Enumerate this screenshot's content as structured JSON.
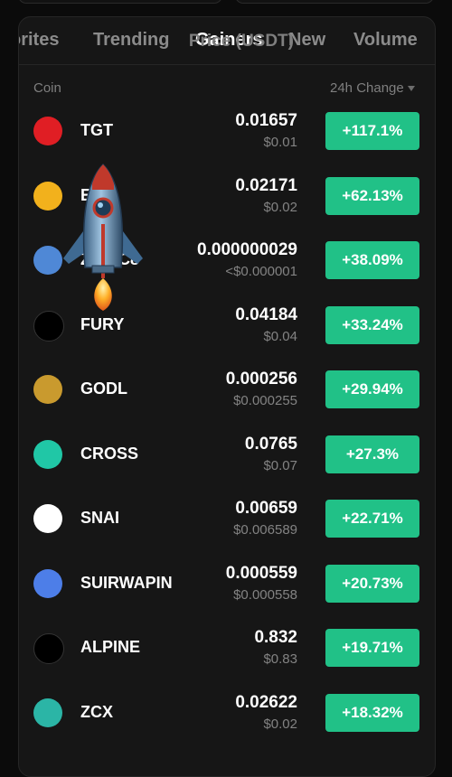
{
  "tabs": [
    {
      "label": "orites"
    },
    {
      "label": "Trending"
    },
    {
      "label": "Gainers"
    },
    {
      "label": "New"
    },
    {
      "label": "Volume"
    }
  ],
  "active_tab": "Gainers",
  "columns": {
    "coin": "Coin",
    "price": "Price (USDT)",
    "change": "24h Change"
  },
  "rows": [
    {
      "symbol": "TGT",
      "price": "0.01657",
      "usd": "$0.01",
      "change": "+117.1%",
      "icon": "tgt-logo-icon",
      "icon_color": "#e01e24"
    },
    {
      "symbol": "E",
      "price": "0.02171",
      "usd": "$0.02",
      "change": "+62.13%",
      "icon": "coin-e-logo-icon",
      "icon_color": "#f2b11c"
    },
    {
      "symbol": "ZU  CC8",
      "price": "0.000000029",
      "usd": "<$0.000001",
      "change": "+38.09%",
      "icon": "dog-logo-icon",
      "icon_color": "#4f88d6"
    },
    {
      "symbol": "FURY",
      "price": "0.04184",
      "usd": "$0.04",
      "change": "+33.24%",
      "icon": "fury-logo-icon",
      "icon_color": "#000000"
    },
    {
      "symbol": "GODL",
      "price": "0.000256",
      "usd": "$0.000255",
      "change": "+29.94%",
      "icon": "godl-logo-icon",
      "icon_color": "#c99a2e"
    },
    {
      "symbol": "CROSS",
      "price": "0.0765",
      "usd": "$0.07",
      "change": "+27.3%",
      "icon": "cross-logo-icon",
      "icon_color": "#20c7a6"
    },
    {
      "symbol": "SNAI",
      "price": "0.00659",
      "usd": "$0.006589",
      "change": "+22.71%",
      "icon": "snai-logo-icon",
      "icon_color": "#ffffff"
    },
    {
      "symbol": "SUIRWAPIN",
      "price": "0.000559",
      "usd": "$0.000558",
      "change": "+20.73%",
      "icon": "suirwapin-logo-icon",
      "icon_color": "#4d7ee8"
    },
    {
      "symbol": "ALPINE",
      "price": "0.832",
      "usd": "$0.83",
      "change": "+19.71%",
      "icon": "alpine-logo-icon",
      "icon_color": "#000000"
    },
    {
      "symbol": "ZCX",
      "price": "0.02622",
      "usd": "$0.02",
      "change": "+18.32%",
      "icon": "zcx-logo-icon",
      "icon_color": "#2bb5a6"
    }
  ],
  "colors": {
    "positive": "#21c187",
    "background": "#161616",
    "muted_text": "#838383"
  },
  "overlay": {
    "icon": "rocket-icon"
  }
}
